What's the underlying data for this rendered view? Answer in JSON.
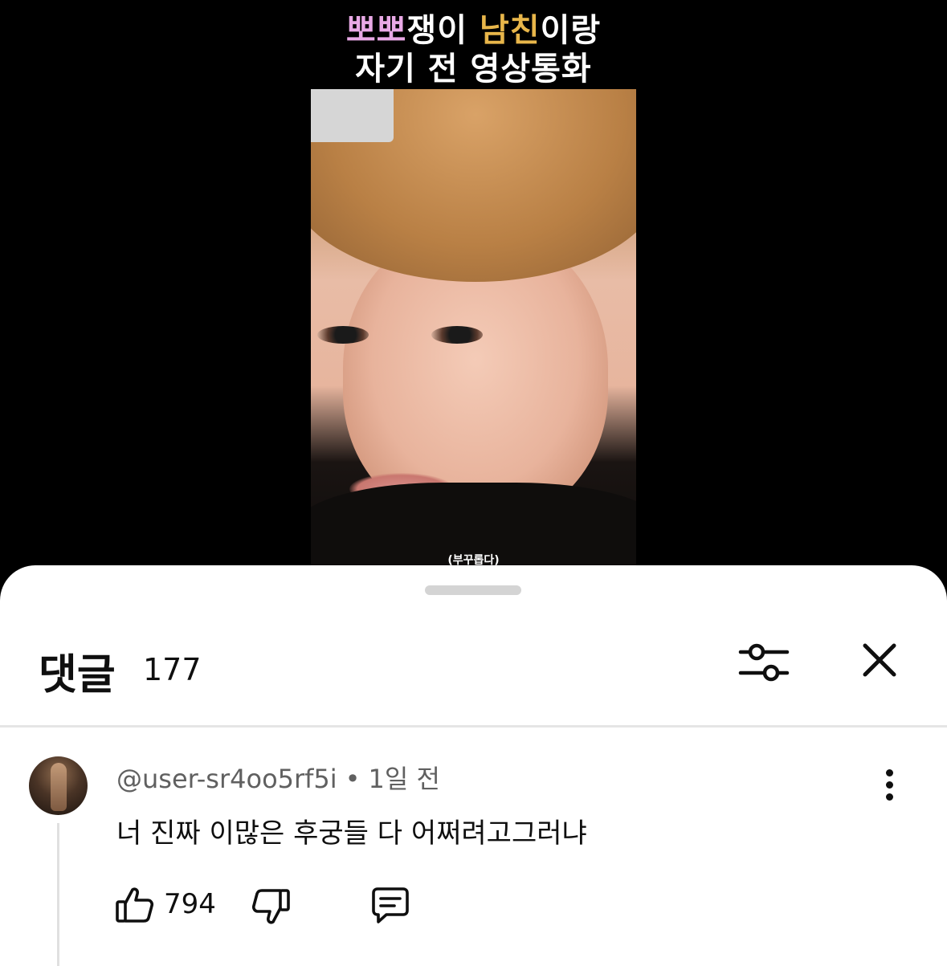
{
  "video": {
    "title_line1": {
      "pink": "뽀뽀",
      "white1": "쟁이 ",
      "gold": "남친",
      "white2": "이랑"
    },
    "title_line2": "자기 전 영상통화",
    "caption": "(부꾸롭다)"
  },
  "comments_panel": {
    "title": "댓글",
    "count": "177",
    "icons": {
      "filter": "sort-filter-icon",
      "close": "close-icon"
    }
  },
  "comments": [
    {
      "author": "@user-sr4oo5rf5i",
      "separator": "•",
      "time": "1일 전",
      "text": "너 진짜 이많은 후궁들 다 어쩌려고그러냐",
      "likes": "794",
      "icons": {
        "like": "thumbs-up-icon",
        "dislike": "thumbs-down-icon",
        "reply": "reply-comment-icon",
        "more": "more-vertical-icon"
      }
    }
  ],
  "colors": {
    "title_pink": "#e9a9e6",
    "title_gold": "#e8b64a",
    "text_primary": "#0f0f0f",
    "text_secondary": "#606060"
  }
}
